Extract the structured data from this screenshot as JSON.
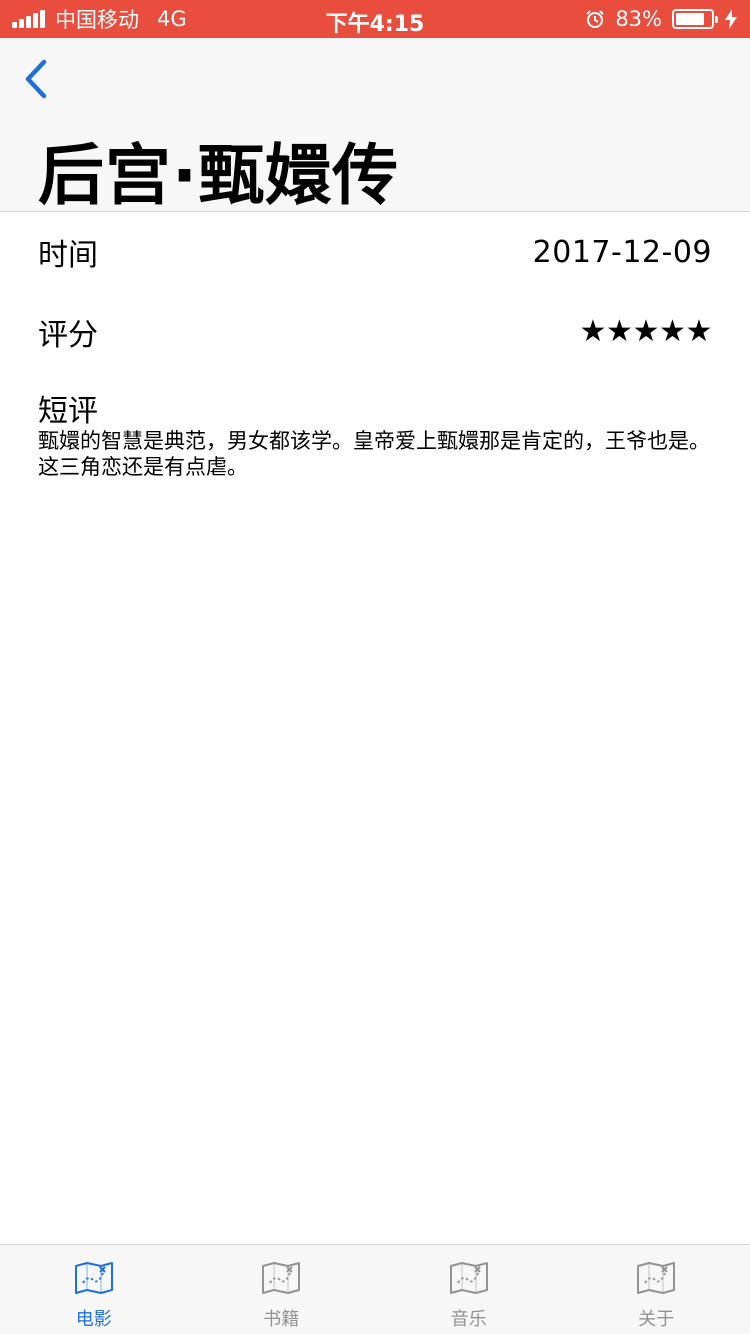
{
  "status_bar": {
    "carrier": "中国移动",
    "network": "4G",
    "time": "下午4:15",
    "battery_percent": "83%",
    "battery_level": 0.83,
    "background_color": "#e84d3d"
  },
  "nav": {
    "back_icon": "chevron-left-icon",
    "title": "后宫·甄嬛传",
    "accent_color": "#1e6fd9"
  },
  "details": {
    "time_label": "时间",
    "time_value": "2017-12-09",
    "rating_label": "评分",
    "rating_stars": 5,
    "rating_glyph": "★",
    "review_label": "短评",
    "review_text": "甄嬛的智慧是典范，男女都该学。皇帝爱上甄嬛那是肯定的，王爷也是。这三角恋还是有点虐。"
  },
  "tabs": [
    {
      "label": "电影",
      "icon": "map-icon",
      "active": true
    },
    {
      "label": "书籍",
      "icon": "map-icon",
      "active": false
    },
    {
      "label": "音乐",
      "icon": "map-icon",
      "active": false
    },
    {
      "label": "关于",
      "icon": "map-icon",
      "active": false
    }
  ]
}
